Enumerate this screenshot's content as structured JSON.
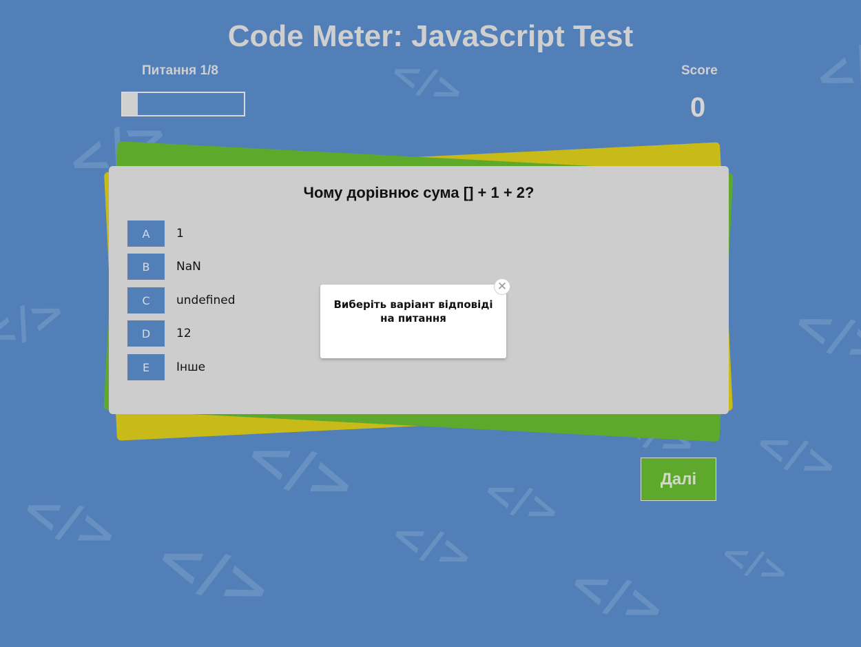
{
  "header": {
    "title": "Code Meter: JavaScript Test"
  },
  "progress": {
    "label": "Питання 1/8",
    "current": 1,
    "total": 8,
    "fraction": 0.125
  },
  "score": {
    "label": "Score",
    "value": "0"
  },
  "quiz": {
    "question": "Чому дорівнює сума [] + 1 + 2?",
    "answers": [
      {
        "letter": "A",
        "text": "1"
      },
      {
        "letter": "B",
        "text": "NaN"
      },
      {
        "letter": "C",
        "text": "undefined"
      },
      {
        "letter": "D",
        "text": "12"
      },
      {
        "letter": "E",
        "text": "Інше"
      }
    ]
  },
  "popup": {
    "message": "Виберіть варіант відповіді на питання",
    "close_icon": "close-icon"
  },
  "next_button": {
    "label": "Далі"
  },
  "background": {
    "symbol": "</>"
  },
  "colors": {
    "background": "#527fb7",
    "card": "#cdcdcd",
    "card_back_yellow": "#c8ba18",
    "card_back_green": "#5ea82b",
    "answer_letter_bg": "#527fb7",
    "next_button_bg": "#5ea82b"
  }
}
